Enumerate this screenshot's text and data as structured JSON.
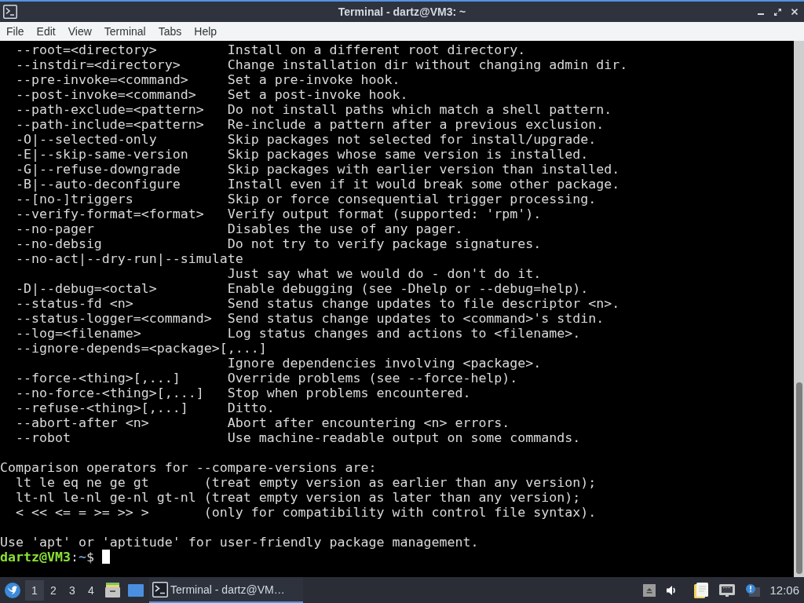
{
  "window": {
    "title": "Terminal - dartz@VM3: ~"
  },
  "menu_bar": {
    "items": [
      "File",
      "Edit",
      "View",
      "Terminal",
      "Tabs",
      "Help"
    ]
  },
  "terminal": {
    "options": [
      {
        "flag": "--root=<directory>",
        "description": "Install on a different root directory."
      },
      {
        "flag": "--instdir=<directory>",
        "description": "Change installation dir without changing admin dir."
      },
      {
        "flag": "--pre-invoke=<command>",
        "description": "Set a pre-invoke hook."
      },
      {
        "flag": "--post-invoke=<command>",
        "description": "Set a post-invoke hook."
      },
      {
        "flag": "--path-exclude=<pattern>",
        "description": "Do not install paths which match a shell pattern."
      },
      {
        "flag": "--path-include=<pattern>",
        "description": "Re-include a pattern after a previous exclusion."
      },
      {
        "flag": "-O|--selected-only",
        "description": "Skip packages not selected for install/upgrade."
      },
      {
        "flag": "-E|--skip-same-version",
        "description": "Skip packages whose same version is installed."
      },
      {
        "flag": "-G|--refuse-downgrade",
        "description": "Skip packages with earlier version than installed."
      },
      {
        "flag": "-B|--auto-deconfigure",
        "description": "Install even if it would break some other package."
      },
      {
        "flag": "--[no-]triggers",
        "description": "Skip or force consequential trigger processing."
      },
      {
        "flag": "--verify-format=<format>",
        "description": "Verify output format (supported: 'rpm')."
      },
      {
        "flag": "--no-pager",
        "description": "Disables the use of any pager."
      },
      {
        "flag": "--no-debsig",
        "description": "Do not try to verify package signatures."
      },
      {
        "flag": "--no-act|--dry-run|--simulate"
      },
      {
        "description": "Just say what we would do - don't do it."
      },
      {
        "flag": "-D|--debug=<octal>",
        "description": "Enable debugging (see -Dhelp or --debug=help)."
      },
      {
        "flag": "--status-fd <n>",
        "description": "Send status change updates to file descriptor <n>."
      },
      {
        "flag": "--status-logger=<command>",
        "description": "Send status change updates to <command>'s stdin."
      },
      {
        "flag": "--log=<filename>",
        "description": "Log status changes and actions to <filename>."
      },
      {
        "flag": "--ignore-depends=<package>[,...]"
      },
      {
        "description": "Ignore dependencies involving <package>."
      },
      {
        "flag": "--force-<thing>[,...]",
        "description": "Override problems (see --force-help)."
      },
      {
        "flag": "--no-force-<thing>[,...]",
        "description": "Stop when problems encountered."
      },
      {
        "flag": "--refuse-<thing>[,...]",
        "description": "Ditto."
      },
      {
        "flag": "--abort-after <n>",
        "description": "Abort after encountering <n> errors."
      },
      {
        "flag": "--robot",
        "description": "Use machine-readable output on some commands."
      }
    ],
    "comparison": {
      "heading": "Comparison operators for --compare-versions are:",
      "rows": [
        {
          "operators": "lt le eq ne ge gt",
          "meaning": "(treat empty version as earlier than any version);"
        },
        {
          "operators": "lt-nl le-nl ge-nl gt-nl",
          "meaning": "(treat empty version as later than any version);"
        },
        {
          "operators": "< << <= = >= >> >",
          "meaning": "(only for compatibility with control file syntax)."
        }
      ]
    },
    "hint": "Use 'apt' or 'aptitude' for user-friendly package management.",
    "prompt": {
      "user_host": "dartz@VM3",
      "separator": ":",
      "path": "~",
      "symbol": "$"
    }
  },
  "taskbar": {
    "workspaces": [
      {
        "label": "1",
        "selected": true
      },
      {
        "label": "2",
        "selected": false
      },
      {
        "label": "3",
        "selected": false
      },
      {
        "label": "4",
        "selected": false
      }
    ],
    "tasks": [
      {
        "label": "Terminal - dartz@VM…",
        "selected": true
      }
    ],
    "clock": "12:06"
  }
}
